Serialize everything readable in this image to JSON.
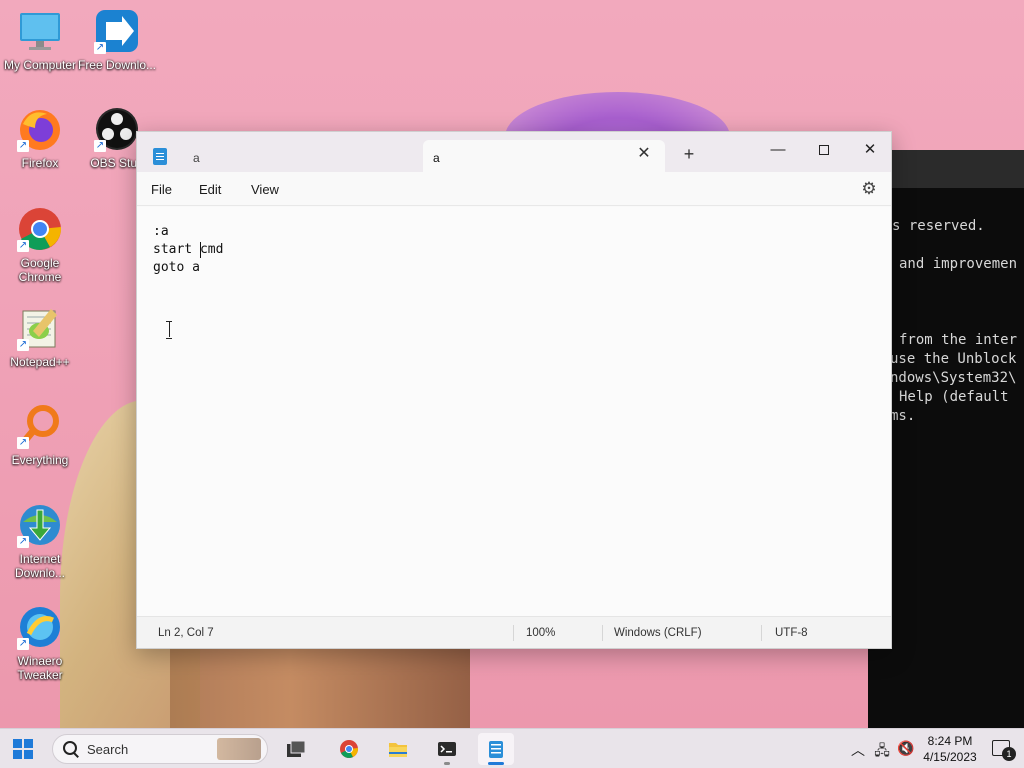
{
  "desktop": {
    "icons": [
      {
        "label": "My Computer",
        "icon": "monitor-icon"
      },
      {
        "label": "Free Downlo...",
        "icon": "download-manager-icon"
      },
      {
        "label": "Firefox",
        "icon": "firefox-icon"
      },
      {
        "label": "OBS Stud",
        "icon": "obs-icon"
      },
      {
        "label": "Google Chrome",
        "icon": "chrome-icon"
      },
      {
        "label": "Notepad++",
        "icon": "notepadpp-icon"
      },
      {
        "label": "Everything",
        "icon": "search-magnifier-icon"
      },
      {
        "label": "Internet Downlo...",
        "icon": "idm-icon"
      },
      {
        "label": "Winaero Tweaker",
        "icon": "winaero-icon"
      }
    ]
  },
  "terminal": {
    "lines": [
      "s reserved.",
      "and improvemen",
      "from the inter",
      "use the Unblock",
      "ndows\\System32\\",
      "Help (default",
      "ms."
    ]
  },
  "notepad": {
    "tabs": [
      {
        "label": "a",
        "active": false
      },
      {
        "label": "a",
        "active": true
      }
    ],
    "new_tab_symbol": "+",
    "close_tab_symbol": "✕",
    "controls": {
      "minimize": "—",
      "close": "✕"
    },
    "menu": {
      "file": "File",
      "edit": "Edit",
      "view": "View"
    },
    "settings_icon": "gear-icon",
    "content_lines": [
      ":a",
      "start cmd",
      "goto a"
    ],
    "status": {
      "position": "Ln 2, Col 7",
      "zoom": "100%",
      "line_ending": "Windows (CRLF)",
      "encoding": "UTF-8"
    }
  },
  "taskbar": {
    "search_placeholder": "Search",
    "clock_time": "8:24 PM",
    "clock_date": "4/15/2023",
    "notification_count": "1",
    "accent": "#1f7ad8"
  }
}
